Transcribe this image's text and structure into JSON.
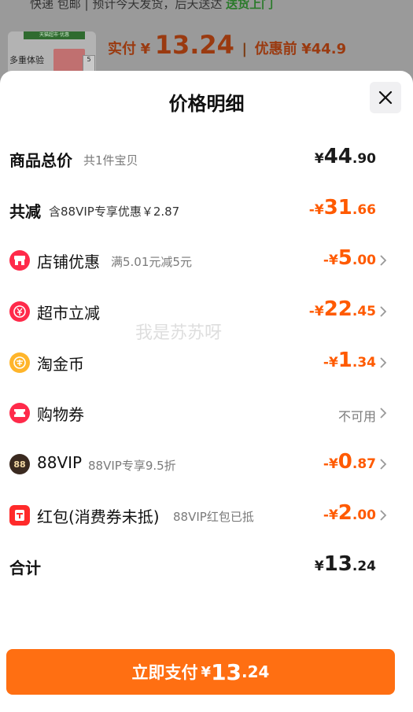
{
  "background": {
    "top_line_text": "快递 包邮 | 预计今天发货，后天送达",
    "top_line_green": "送货上门",
    "thumb_ribbon": "天猫超市·优惠",
    "thumb_text": "多重体验",
    "thumb_badge": "5",
    "paid_label": "实付",
    "paid_currency": "¥",
    "paid_amount": "13.24",
    "before_label": "优惠前",
    "before_amount": "¥44.9"
  },
  "sheet": {
    "title": "价格明细",
    "watermark": "我是苏苏呀"
  },
  "rows": [
    {
      "label": "商品总价",
      "sub": "共1件宝贝",
      "currency": "¥",
      "int": "44",
      "dec": ".90",
      "style": "dark"
    },
    {
      "label": "共减",
      "sub": "含88VIP专享优惠￥2.87",
      "currency": "-¥",
      "int": "31",
      "dec": ".66",
      "style": "orange"
    },
    {
      "label": "店铺优惠",
      "sub": "满5.01元减5元",
      "currency": "-¥",
      "int": "5",
      "dec": ".00",
      "style": "orange",
      "icon": "shop-icon"
    },
    {
      "label": "超市立减",
      "sub": "",
      "currency": "-¥",
      "int": "22",
      "dec": ".45",
      "style": "orange",
      "icon": "supermarket-discount-icon"
    },
    {
      "label": "淘金币",
      "sub": "",
      "currency": "-¥",
      "int": "1",
      "dec": ".34",
      "style": "orange",
      "icon": "gold-coin-icon"
    },
    {
      "label": "购物券",
      "sub": "",
      "text": "不可用",
      "style": "na",
      "icon": "coupon-icon"
    },
    {
      "label": "88VIP",
      "sub": "88VIP专享9.5折",
      "currency": "-¥",
      "int": "0",
      "dec": ".87",
      "style": "orange",
      "icon": "vip-88-icon"
    },
    {
      "label": "红包(消费券未抵)",
      "sub": "88VIP红包已抵",
      "currency": "-¥",
      "int": "2",
      "dec": ".00",
      "style": "orange",
      "icon": "red-packet-icon"
    },
    {
      "label": "合计",
      "sub": "",
      "currency": "¥",
      "int": "13",
      "dec": ".24",
      "style": "dark"
    }
  ],
  "pay_button": {
    "label": "立即支付",
    "currency": "¥",
    "int": "13",
    "dec": ".24"
  },
  "colors": {
    "accent": "#ff5a00",
    "button": "#ff6f12",
    "icon_red": "#ff2a4a",
    "icon_gold": "#ffb52a",
    "icon_dark": "#3a2a20"
  }
}
